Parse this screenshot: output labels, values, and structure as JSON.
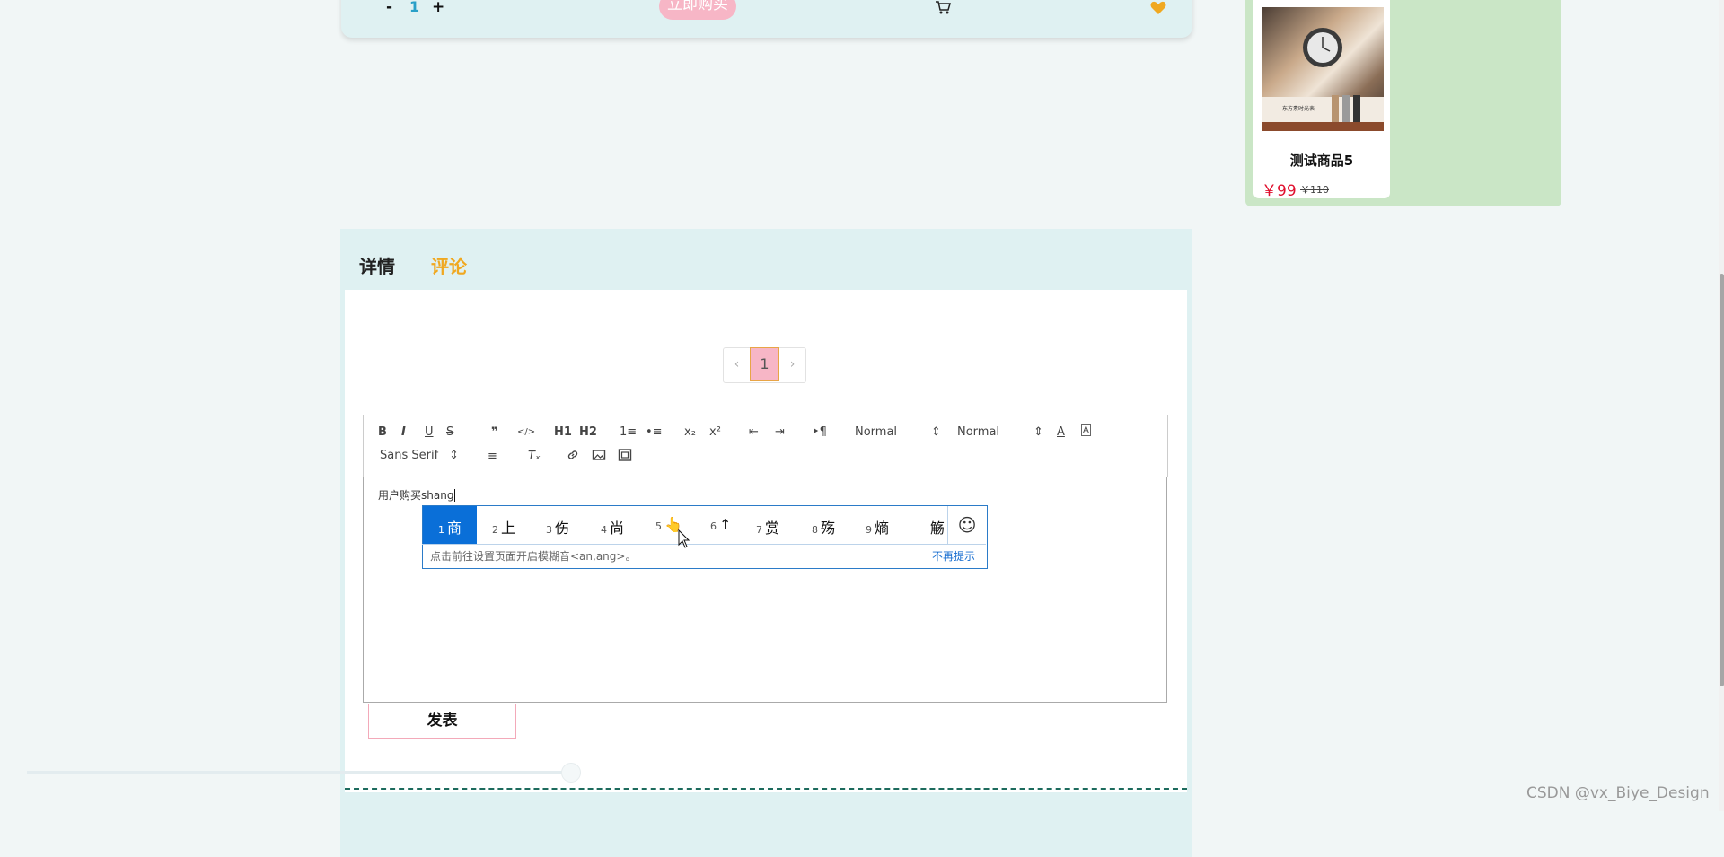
{
  "product": {
    "qty_minus": "-",
    "qty_value": "1",
    "qty_plus": "+",
    "buy_now": "立即购买",
    "cart_icon": "cart-icon",
    "favorite_icon": "heart-icon"
  },
  "recommend": {
    "name": "测试商品5",
    "price": "￥99",
    "old_price": "￥110",
    "image_caption": "东方素时光表"
  },
  "tabs": [
    "详情",
    "评论"
  ],
  "active_tab": "评论",
  "pagination": {
    "prev": "‹",
    "page": "1",
    "next": "›"
  },
  "editor": {
    "toolbar": {
      "bold": "B",
      "italic": "I",
      "underline": "U",
      "strike": "S",
      "blockquote": "❞",
      "code": "</>",
      "h1": "H1",
      "h2": "H2",
      "ol": "1≡",
      "ul": "•≡",
      "sub": "x₂",
      "sup": "x²",
      "outdent": "⇤",
      "indent": "⇥",
      "direction": "‣¶",
      "size": "Normal",
      "header": "Normal",
      "font": "Sans Serif",
      "align": "≡",
      "clean": "Tₓ"
    },
    "content": "用户购买shang"
  },
  "ime": {
    "candidates": [
      {
        "n": "1",
        "c": "商"
      },
      {
        "n": "2",
        "c": "上"
      },
      {
        "n": "3",
        "c": "伤"
      },
      {
        "n": "4",
        "c": "尚"
      },
      {
        "n": "5",
        "c": "👆"
      },
      {
        "n": "6",
        "c": "↑"
      },
      {
        "n": "7",
        "c": "赏"
      },
      {
        "n": "8",
        "c": "殇"
      },
      {
        "n": "9",
        "c": "熵"
      },
      {
        "n": "",
        "c": "觞"
      }
    ],
    "hint": "点击前往设置页面开启模糊音<an,ang>。",
    "dismiss": "不再提示",
    "emoji": "☺"
  },
  "submit": "发表",
  "watermark": "CSDN @vx_Biye_Design",
  "colors": {
    "accent": "#f0a820",
    "pink": "#f7b6c6",
    "price": "#e0102e",
    "ime": "#0a6fd8"
  }
}
